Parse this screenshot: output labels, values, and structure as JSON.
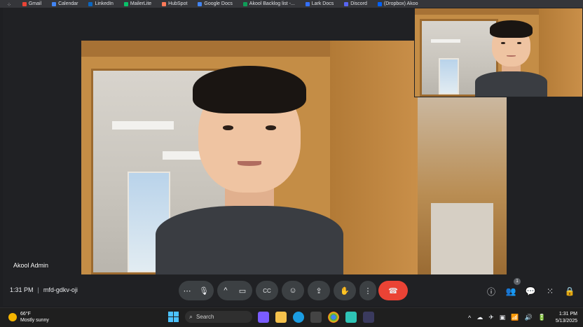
{
  "browser": {
    "bookmarks": [
      {
        "label": "Gmail",
        "color": "#ea4335"
      },
      {
        "label": "Calendar",
        "color": "#4285f4"
      },
      {
        "label": "LinkedIn",
        "color": "#0a66c2"
      },
      {
        "label": "MailerLite",
        "color": "#09c269"
      },
      {
        "label": "HubSpot",
        "color": "#ff7a59"
      },
      {
        "label": "Google Docs",
        "color": "#4285f4"
      },
      {
        "label": "Akool Backlog list -...",
        "color": "#0f9d58"
      },
      {
        "label": "Lark Docs",
        "color": "#3370ff"
      },
      {
        "label": "Discord",
        "color": "#5865f2"
      },
      {
        "label": "(Dropbox) Akoo",
        "color": "#0061ff"
      }
    ]
  },
  "meeting": {
    "participant_name": "Akool Admin",
    "time": "1:31 PM",
    "separator": "|",
    "code": "mfd-gdkv-oji",
    "people_count": "1",
    "controls": {
      "more": "⋯",
      "mic": "🎙",
      "chevron": "^",
      "camera": "▭",
      "captions": "CC",
      "emoji": "☺",
      "present": "⇪",
      "hand": "✋",
      "options": "⋮",
      "end_call": "☎"
    },
    "right": {
      "info": "ⓘ",
      "people": "👥",
      "chat": "💬",
      "activities": "⁙",
      "host": "🔒"
    }
  },
  "taskbar": {
    "weather_temp": "66°F",
    "weather_desc": "Mostly sunny",
    "search_placeholder": "Search",
    "time": "1:31 PM",
    "date": "5/13/2025",
    "tray": [
      "^",
      "☁",
      "✈",
      "▣",
      "📶",
      "🔊",
      "🔋"
    ]
  }
}
